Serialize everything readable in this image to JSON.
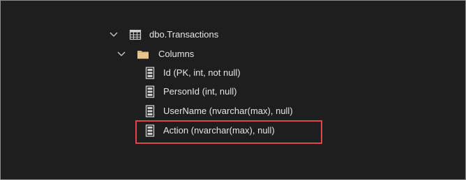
{
  "tree": {
    "table": {
      "label": "dbo.Transactions",
      "icon": "table-icon",
      "expanded": true
    },
    "folder": {
      "label": "Columns",
      "icon": "folder-icon",
      "expanded": true
    },
    "columns": [
      {
        "label": "Id (PK, int, not null)",
        "icon": "column-icon"
      },
      {
        "label": "PersonId (int, null)",
        "icon": "column-icon"
      },
      {
        "label": "UserName (nvarchar(max), null)",
        "icon": "column-icon"
      },
      {
        "label": "Action (nvarchar(max), null)",
        "icon": "column-icon",
        "highlighted": true
      }
    ]
  },
  "colors": {
    "background": "#1e1e1e",
    "text": "#e6e6e6",
    "highlight_border": "#e2444a",
    "folder": "#dcb67a"
  }
}
